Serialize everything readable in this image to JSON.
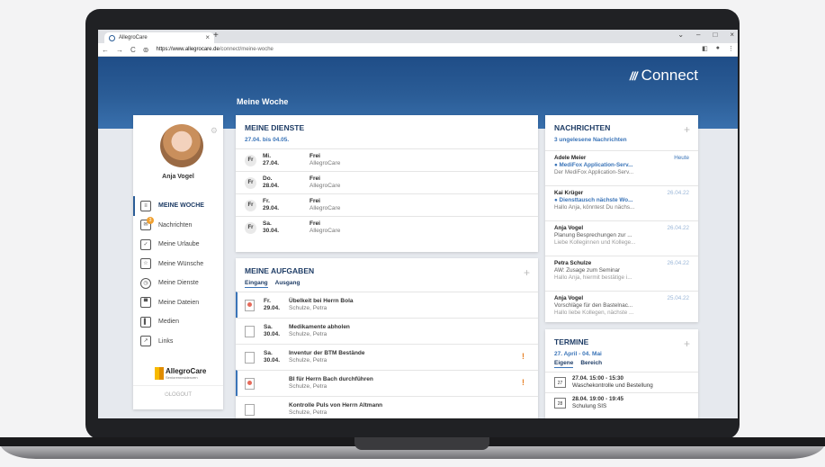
{
  "browser": {
    "tab_title": "AllegroCare",
    "url_host": "https://www.allegrocare.de",
    "url_path": "/connect/meine-woche"
  },
  "header": {
    "brand_logo": "///",
    "brand": "Connect",
    "page_title": "Meine Woche"
  },
  "sidebar": {
    "user_name": "Anja Vogel",
    "items": [
      {
        "label": "MEINE WOCHE",
        "icon": "clipboard-icon",
        "active": true
      },
      {
        "label": "Nachrichten",
        "icon": "mail-icon",
        "badge": "3"
      },
      {
        "label": "Meine Urlaube",
        "icon": "calendar-check-icon"
      },
      {
        "label": "Meine Wünsche",
        "icon": "calendar-star-icon"
      },
      {
        "label": "Meine Dienste",
        "icon": "stopwatch-icon"
      },
      {
        "label": "Meine Dateien",
        "icon": "file-icon"
      },
      {
        "label": "Medien",
        "icon": "book-icon"
      },
      {
        "label": "Links",
        "icon": "link-icon"
      }
    ],
    "company_name": "AllegroCare",
    "company_sub": "Seniorenresidenzen",
    "logout": "LOGOUT"
  },
  "dienste": {
    "title": "MEINE DIENSTE",
    "range": "27.04. bis 04.05.",
    "rows": [
      {
        "badge": "Fr",
        "day": "Mi.",
        "date": "27.04.",
        "status": "Frei",
        "org": "AllegroCare"
      },
      {
        "badge": "Fr",
        "day": "Do.",
        "date": "28.04.",
        "status": "Frei",
        "org": "AllegroCare"
      },
      {
        "badge": "Fr",
        "day": "Fr.",
        "date": "29.04.",
        "status": "Frei",
        "org": "AllegroCare"
      },
      {
        "badge": "Fr",
        "day": "Sa.",
        "date": "30.04.",
        "status": "Frei",
        "org": "AllegroCare"
      }
    ]
  },
  "aufgaben": {
    "title": "MEINE AUFGABEN",
    "tabs": [
      "Eingang",
      "Ausgang"
    ],
    "rows": [
      {
        "day": "Fr.",
        "date": "29.04.",
        "title": "Übelkeit bei Herrn Bola",
        "person": "Schulze, Petra"
      },
      {
        "day": "Sa.",
        "date": "30.04.",
        "title": "Medikamente abholen",
        "person": "Schulze, Petra"
      },
      {
        "day": "Sa.",
        "date": "30.04.",
        "title": "Inventur der BTM Bestände",
        "person": "Schulze, Petra",
        "flag": "!"
      },
      {
        "day": "",
        "date": "",
        "title": "BI für Herrn Bach durchführen",
        "person": "Schulze, Petra",
        "flag": "!"
      },
      {
        "day": "",
        "date": "",
        "title": "Kontrolle Puls von Herrn Altmann",
        "person": "Schulze, Petra"
      }
    ]
  },
  "nachrichten": {
    "title": "NACHRICHTEN",
    "unread": "3 ungelesene Nachrichten",
    "rows": [
      {
        "sender": "Adele Meier",
        "date": "Heute",
        "subject": "● MediFox Application-Serv...",
        "preview": "Der MediFox Application-Serv..."
      },
      {
        "sender": "Kai Krüger",
        "date": "26.04.22",
        "subject": "● Diensttausch nächste Wo...",
        "preview": "Hallo Anja, könntest Du nächs..."
      },
      {
        "sender": "Anja Vogel",
        "date": "26.04.22",
        "subject": "Planung Besprechungen zur ...",
        "preview": "Liebe Kolleginnen und Kollege..."
      },
      {
        "sender": "Petra Schulze",
        "date": "26.04.22",
        "subject": "AW: Zusage zum Seminar",
        "preview": "Hallo Anja, hiermit bestätige i..."
      },
      {
        "sender": "Anja Vogel",
        "date": "25.04.22",
        "subject": "Vorschläge für den Bastelnac...",
        "preview": "Hallo liebe Kollegen, nächste ..."
      }
    ]
  },
  "termine": {
    "title": "TERMINE",
    "range": "27. April - 04. Mai",
    "tabs": [
      "Eigene",
      "Bereich"
    ],
    "rows": [
      {
        "day": "27",
        "time": "27.04. 15:00 - 15:30",
        "title": "Waschekontrolle und Bestellung"
      },
      {
        "day": "28",
        "time": "28.04. 19:00 - 19:45",
        "title": "Schulung SIS"
      }
    ]
  }
}
